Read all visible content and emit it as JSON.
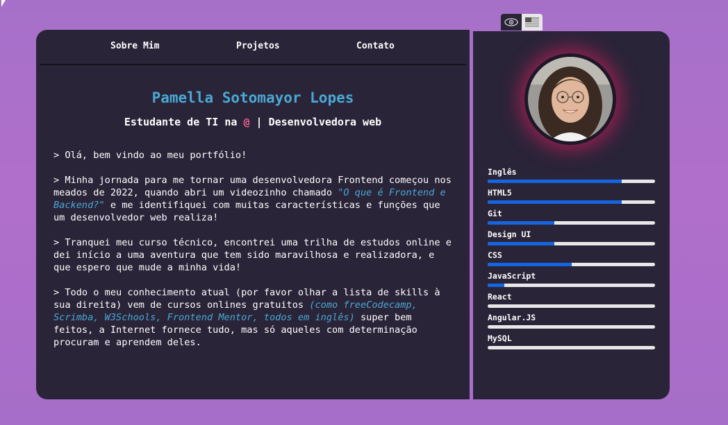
{
  "nav": {
    "about": "Sobre Mim",
    "projects": "Projetos",
    "contact": "Contato"
  },
  "header": {
    "name": "Pamella Sotomayor Lopes",
    "subtitle_start": "Estudante de TI na ",
    "subtitle_at": "@",
    "subtitle_end": " | Desenvolvedora web"
  },
  "bio": {
    "p1": "> Olá, bem vindo ao meu portfólio!",
    "p2_start": "> Minha jornada para me tornar uma desenvolvedora Frontend começou nos meados de 2022, quando abri um videozinho chamado ",
    "p2_em": "\"O que é Frontend e Backend?\"",
    "p2_end": " e me identifiquei com muitas características e funções que um desenvolvedor web realiza!",
    "p3": "> Tranquei meu curso técnico, encontrei uma trilha de estudos online e dei início a uma aventura que tem sido maravilhosa e realizadora, e que espero que mude a minha vida!",
    "p4_start": "> Todo o meu conhecimento atual (por favor olhar a lista de skills à sua direita) vem de cursos onlines gratuitos ",
    "p4_em": "(como freeCodecamp, Scrimba, W3Schools, Frontend Mentor, todos em inglês)",
    "p4_end": " super bem feitos, a Internet fornece tudo, mas só aqueles com determinação procuram e aprendem deles."
  },
  "skills": [
    {
      "label": "Inglês",
      "level": 0.8
    },
    {
      "label": "HTML5",
      "level": 0.8
    },
    {
      "label": "Git",
      "level": 0.4
    },
    {
      "label": "Design UI",
      "level": 0.4
    },
    {
      "label": "CSS",
      "level": 0.5
    },
    {
      "label": "JavaScript",
      "level": 0.1
    },
    {
      "label": "React",
      "level": 0
    },
    {
      "label": "Angular.JS",
      "level": 0
    },
    {
      "label": "MySQL",
      "level": 0
    }
  ],
  "colors": {
    "accent": "#4aa8d4",
    "highlight": "#f06292",
    "bar_fill": "#1565e0",
    "card": "#2a2438"
  },
  "icons": {
    "lang_active": "eye-icon",
    "lang_alt": "us-flag-icon"
  }
}
